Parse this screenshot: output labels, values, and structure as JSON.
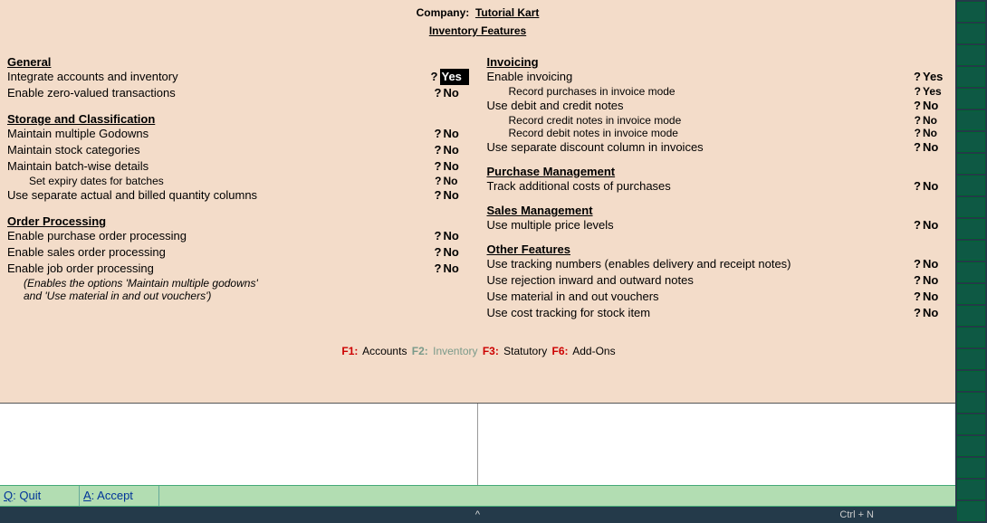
{
  "header": {
    "company_label": "Company:",
    "company": "Tutorial Kart",
    "title": "Inventory Features"
  },
  "left": {
    "section1": "General",
    "r1": {
      "label": "Integrate accounts and inventory",
      "val": "Yes"
    },
    "r2": {
      "label": "Enable zero-valued transactions",
      "val": "No"
    },
    "section2": "Storage and Classification",
    "r3": {
      "label": "Maintain multiple Godowns",
      "val": "No"
    },
    "r4": {
      "label": "Maintain stock categories",
      "val": "No"
    },
    "r5": {
      "label": "Maintain batch-wise details",
      "val": "No"
    },
    "r5a": {
      "label": "Set expiry dates for batches",
      "val": "No"
    },
    "r6": {
      "label": "Use separate actual and billed quantity columns",
      "val": "No"
    },
    "section3": "Order Processing",
    "r7": {
      "label": "Enable purchase order processing",
      "val": "No"
    },
    "r8": {
      "label": "Enable sales order processing",
      "val": "No"
    },
    "r9": {
      "label": "Enable job order processing",
      "val": "No"
    },
    "note1": "(Enables the options 'Maintain multiple godowns'",
    "note2": "and 'Use material in and out vouchers')"
  },
  "right": {
    "section1": "Invoicing",
    "r1": {
      "label": "Enable invoicing",
      "val": "Yes"
    },
    "r1a": {
      "label": "Record purchases in invoice mode",
      "val": "Yes"
    },
    "r2": {
      "label": "Use debit and credit notes",
      "val": "No"
    },
    "r2a": {
      "label": "Record credit notes in invoice mode",
      "val": "No"
    },
    "r2b": {
      "label": "Record debit notes in invoice mode",
      "val": "No"
    },
    "r3": {
      "label": "Use separate discount column in invoices",
      "val": "No"
    },
    "section2": "Purchase Management",
    "r4": {
      "label": "Track additional costs of purchases",
      "val": "No"
    },
    "section3": "Sales Management",
    "r5": {
      "label": "Use multiple price levels",
      "val": "No"
    },
    "section4": "Other Features",
    "r6": {
      "label": "Use tracking numbers (enables delivery and receipt notes)",
      "val": "No"
    },
    "r7": {
      "label": "Use rejection inward and outward notes",
      "val": "No"
    },
    "r8": {
      "label": "Use material in and out vouchers",
      "val": "No"
    },
    "r9": {
      "label": "Use cost tracking for stock item",
      "val": "No"
    }
  },
  "fkeys": {
    "f1": "F1:",
    "f1t": "Accounts",
    "f2": "F2:",
    "f2t": "Inventory",
    "f3": "F3:",
    "f3t": "Statutory",
    "f6": "F6:",
    "f6t": "Add-Ons"
  },
  "buttons": {
    "quitKey": "Q",
    "quit": ": Quit",
    "acceptKey": "A",
    "accept": ": Accept"
  },
  "status": {
    "caret": "^",
    "ctrl": "Ctrl + N"
  },
  "q": "?"
}
